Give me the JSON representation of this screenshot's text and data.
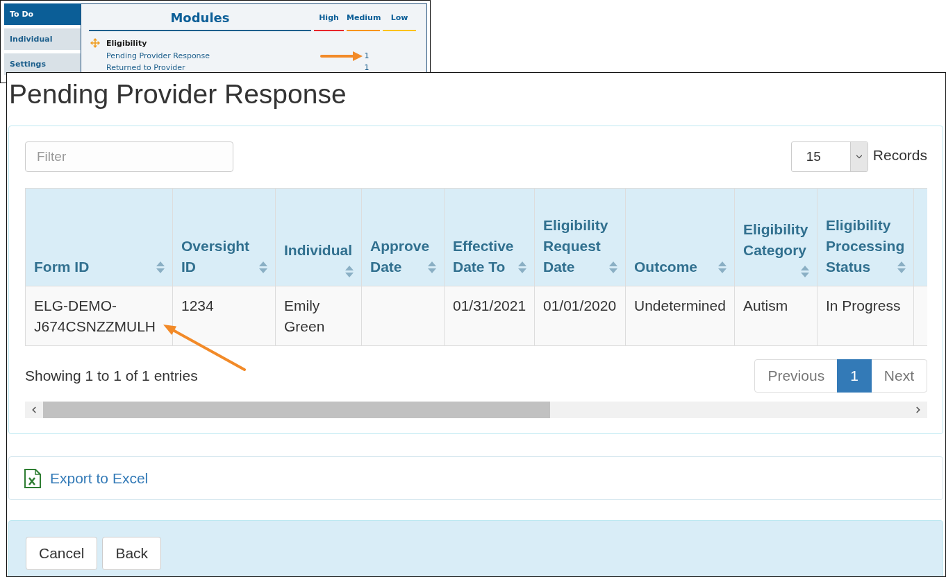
{
  "inset": {
    "nav_tabs": [
      {
        "label": "To Do",
        "selected": true
      },
      {
        "label": "Individual",
        "selected": false
      },
      {
        "label": "Settings",
        "selected": false
      }
    ],
    "modules": {
      "title": "Modules",
      "priorities": [
        {
          "label": "High",
          "kind": "high",
          "color": "#e8262b"
        },
        {
          "label": "Medium",
          "kind": "medium",
          "color": "#f7941d"
        },
        {
          "label": "Low",
          "kind": "low",
          "color": "#fcc21b"
        }
      ],
      "groups": [
        {
          "title": "Eligibility",
          "items": [
            {
              "label": "Pending Provider Response",
              "counts": {
                "medium": "1"
              }
            },
            {
              "label": "Returned to Provider",
              "counts": {
                "medium": "1"
              }
            }
          ]
        }
      ]
    }
  },
  "page": {
    "title": "Pending Provider Response"
  },
  "filter": {
    "placeholder": "Filter"
  },
  "page_size": {
    "value": "15",
    "label": "Records"
  },
  "table": {
    "columns": [
      "Form ID",
      "Oversight ID",
      "Individual",
      "Approve Date",
      "Effective Date To",
      "Eligibility Request Date",
      "Outcome",
      "Eligibility Category",
      "Eligibility Processing Status"
    ],
    "rows": [
      {
        "cells": [
          "ELG-DEMO-J674CSNZZMULH",
          "1234",
          "Emily Green",
          null,
          "01/31/2021",
          "01/01/2020",
          "Undetermined",
          "Autism",
          "In Progress"
        ]
      }
    ]
  },
  "info": "Showing 1 to 1 of 1 entries",
  "pagination": [
    {
      "label": "Previous",
      "selected": false,
      "disabled": true
    },
    {
      "label": "1",
      "selected": true,
      "disabled": false
    },
    {
      "label": "Next",
      "selected": false,
      "disabled": true
    }
  ],
  "export": {
    "label": "Export to Excel"
  },
  "actions": [
    "Cancel",
    "Back"
  ]
}
